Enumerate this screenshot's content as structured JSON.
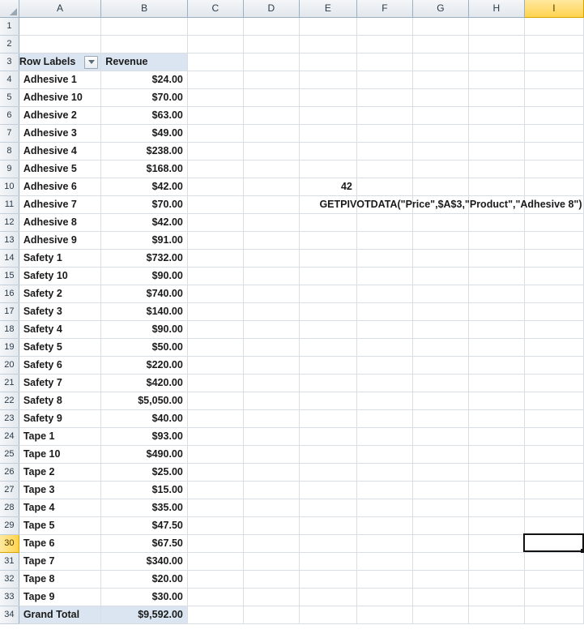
{
  "app": {
    "type": "spreadsheet",
    "select_all_icon": "select-all-corner-icon"
  },
  "grid": {
    "column_headers": [
      "A",
      "B",
      "C",
      "D",
      "E",
      "F",
      "G",
      "H",
      "I"
    ],
    "active_column": "I",
    "active_row": "30",
    "active_cell": "I30",
    "row_numbers": [
      "1",
      "2",
      "3",
      "4",
      "5",
      "6",
      "7",
      "8",
      "9",
      "10",
      "11",
      "12",
      "13",
      "14",
      "15",
      "16",
      "17",
      "18",
      "19",
      "20",
      "21",
      "22",
      "23",
      "24",
      "25",
      "26",
      "27",
      "28",
      "29",
      "30",
      "31",
      "32",
      "33",
      "34"
    ]
  },
  "pivot": {
    "header": {
      "row_labels": "Row Labels",
      "revenue": "Revenue",
      "filter_icon": "filter-dropdown-icon"
    },
    "rows": [
      {
        "label": "Adhesive 1",
        "revenue": "$24.00"
      },
      {
        "label": "Adhesive 10",
        "revenue": "$70.00"
      },
      {
        "label": "Adhesive 2",
        "revenue": "$63.00"
      },
      {
        "label": "Adhesive 3",
        "revenue": "$49.00"
      },
      {
        "label": "Adhesive 4",
        "revenue": "$238.00"
      },
      {
        "label": "Adhesive 5",
        "revenue": "$168.00"
      },
      {
        "label": "Adhesive 6",
        "revenue": "$42.00"
      },
      {
        "label": "Adhesive 7",
        "revenue": "$70.00"
      },
      {
        "label": "Adhesive 8",
        "revenue": "$42.00"
      },
      {
        "label": "Adhesive 9",
        "revenue": "$91.00"
      },
      {
        "label": "Safety 1",
        "revenue": "$732.00"
      },
      {
        "label": "Safety 10",
        "revenue": "$90.00"
      },
      {
        "label": "Safety 2",
        "revenue": "$740.00"
      },
      {
        "label": "Safety 3",
        "revenue": "$140.00"
      },
      {
        "label": "Safety 4",
        "revenue": "$90.00"
      },
      {
        "label": "Safety 5",
        "revenue": "$50.00"
      },
      {
        "label": "Safety 6",
        "revenue": "$220.00"
      },
      {
        "label": "Safety 7",
        "revenue": "$420.00"
      },
      {
        "label": "Safety 8",
        "revenue": "$5,050.00"
      },
      {
        "label": "Safety 9",
        "revenue": "$40.00"
      },
      {
        "label": "Tape 1",
        "revenue": "$93.00"
      },
      {
        "label": "Tape 10",
        "revenue": "$490.00"
      },
      {
        "label": "Tape 2",
        "revenue": "$25.00"
      },
      {
        "label": "Tape 3",
        "revenue": "$15.00"
      },
      {
        "label": "Tape 4",
        "revenue": "$35.00"
      },
      {
        "label": "Tape 5",
        "revenue": "$47.50"
      },
      {
        "label": "Tape 6",
        "revenue": "$67.50"
      },
      {
        "label": "Tape 7",
        "revenue": "$340.00"
      },
      {
        "label": "Tape 8",
        "revenue": "$20.00"
      },
      {
        "label": "Tape 9",
        "revenue": "$30.00"
      }
    ],
    "grand_total": {
      "label": "Grand Total",
      "revenue": "$9,592.00"
    }
  },
  "annotations": {
    "result_cell": {
      "ref": "E10",
      "value": "42"
    },
    "formula_cell": {
      "ref": "E11",
      "value": "GETPIVOTDATA(\"Price\",$A$3,\"Product\",\"Adhesive 8\")"
    }
  },
  "colors": {
    "pivot_fill": "#dbe5f1",
    "header_strip": "#e2e7ed",
    "active_header": "#ffd44f",
    "grid_line": "#d8dee4",
    "selection_border": "#111111"
  }
}
